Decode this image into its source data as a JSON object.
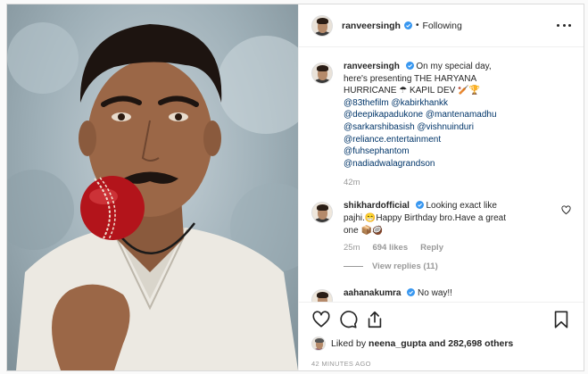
{
  "post_author": {
    "username": "ranveersingh",
    "follow_state": "Following"
  },
  "caption": {
    "username": "ranveersingh",
    "text": "On my special day, here's presenting THE HARYANA HURRICANE ☂ KAPIL DEV 🏏🏆",
    "mentions": [
      "@83thefilm @kabirkhankk",
      "@deepikapadukone @mantenamadhu",
      "@sarkarshibasish @vishnuinduri",
      "@reliance.entertainment",
      "@fuhsephantom",
      "@nadiadwalagrandson"
    ],
    "time": "42m"
  },
  "comments": [
    {
      "username": "shikhardofficial",
      "text": "Looking exact like pajhi.😁Happy Birthday bro.Have a great one 📦🥥",
      "time": "25m",
      "likes": "694 likes",
      "reply_label": "Reply",
      "view_replies": "View replies (11)"
    },
    {
      "username": "aahanakumra",
      "text": "No way!!"
    }
  ],
  "likes": {
    "liked_by_label": "Liked by",
    "liked_by_user": "neena_gupta",
    "others": "and 282,698 others"
  },
  "timestamp": "42 MINUTES AGO",
  "colors": {
    "verified_blue": "#3897f0",
    "mention_blue": "#003569",
    "ball_red": "#b3141b"
  },
  "icons": [
    "more-icon",
    "verified-icon",
    "heart-icon",
    "comment-icon",
    "share-icon",
    "bookmark-icon"
  ]
}
